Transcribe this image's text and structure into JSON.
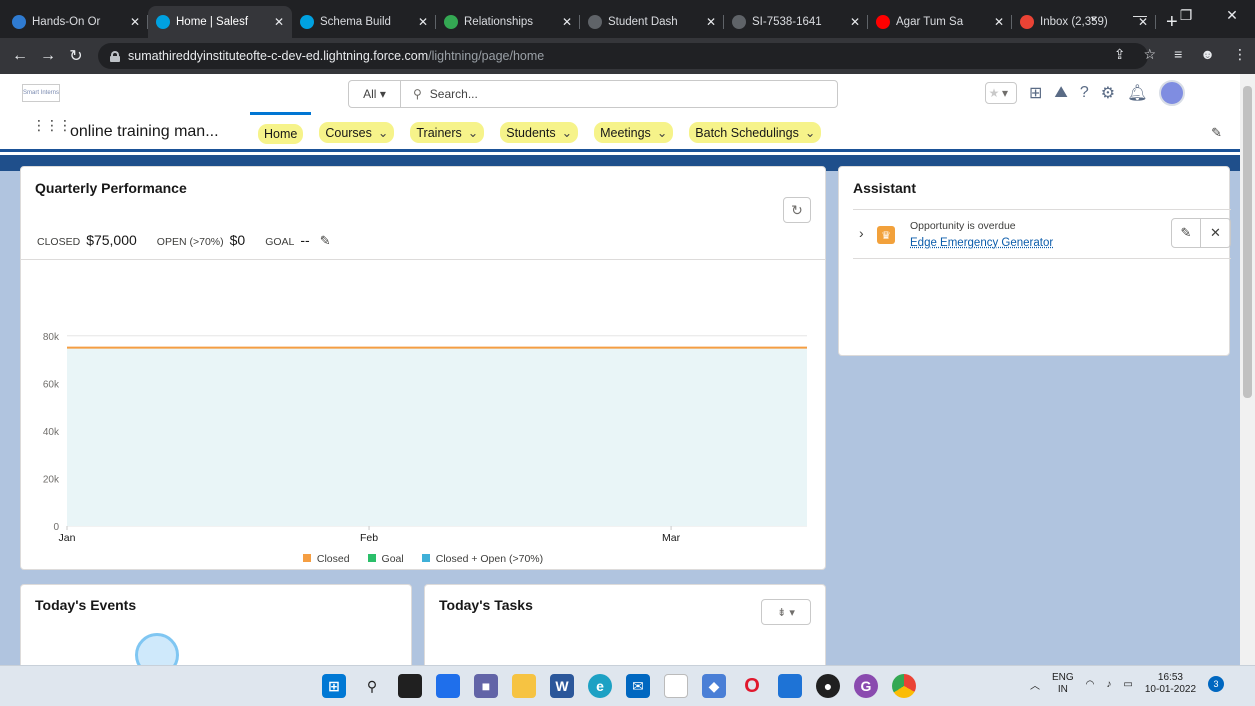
{
  "browser": {
    "tabs": [
      {
        "title": "Hands-On Or",
        "fav_color": "#2f7bd1",
        "active": false
      },
      {
        "title": "Home | Salesf",
        "fav_color": "#00a1e0",
        "active": true
      },
      {
        "title": "Schema Build",
        "fav_color": "#00a1e0",
        "active": false
      },
      {
        "title": "Relationships",
        "fav_color": "#34a853",
        "active": false
      },
      {
        "title": "Student Dash",
        "fav_color": "#5f6368",
        "active": false
      },
      {
        "title": "SI-7538-1641",
        "fav_color": "#5f6368",
        "active": false
      },
      {
        "title": "Agar Tum Sa",
        "fav_color": "#ff0000",
        "active": false
      },
      {
        "title": "Inbox (2,359)",
        "fav_color": "#ea4335",
        "active": false
      }
    ],
    "url_host": "sumathireddyinstituteofte-c-dev-ed.lightning.force.com",
    "url_path": "/lightning/page/home"
  },
  "header": {
    "logo_text": "Smart Interns",
    "search_scope": "All",
    "search_placeholder": "Search..."
  },
  "nav": {
    "app_name": "online training man...",
    "items": [
      {
        "label": "Home",
        "active": true
      },
      {
        "label": "Courses"
      },
      {
        "label": "Trainers"
      },
      {
        "label": "Students"
      },
      {
        "label": "Meetings"
      },
      {
        "label": "Batch Schedulings"
      }
    ]
  },
  "quarterly": {
    "title": "Quarterly Performance",
    "closed_label": "CLOSED",
    "closed_value": "$75,000",
    "open_label": "OPEN (>70%)",
    "open_value": "$0",
    "goal_label": "GOAL",
    "goal_value": "--"
  },
  "chart_data": {
    "type": "line",
    "x": [
      "Jan",
      "Feb",
      "Mar"
    ],
    "y_ticks": [
      "0",
      "20k",
      "40k",
      "60k",
      "80k"
    ],
    "ylim": [
      0,
      90000
    ],
    "series": [
      {
        "name": "Closed",
        "color": "#f59e42",
        "values": [
          75000,
          75000,
          75000
        ]
      },
      {
        "name": "Goal",
        "color": "#2bbf6a",
        "values": []
      },
      {
        "name": "Closed + Open (>70%)",
        "color": "#3fb0d8",
        "values": [
          75000,
          75000,
          75000
        ]
      }
    ],
    "legend": "bottom"
  },
  "assistant": {
    "title": "Assistant",
    "item_label": "Opportunity is overdue",
    "item_link": "Edge Emergency Generator"
  },
  "events": {
    "title": "Today's Events"
  },
  "tasks": {
    "title": "Today's Tasks"
  },
  "taskbar": {
    "lang_top": "ENG",
    "lang_bottom": "IN",
    "time": "16:53",
    "date": "10-01-2022",
    "notifications": "3"
  }
}
